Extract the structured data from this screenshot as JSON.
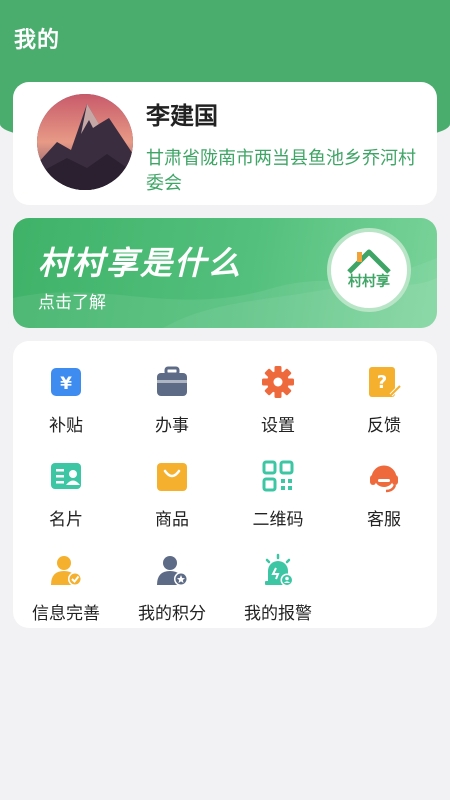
{
  "header": {
    "title": "我的"
  },
  "profile": {
    "name": "李建国",
    "address": "甘肃省陇南市两当县鱼池乡乔河村委会"
  },
  "banner": {
    "title": "村村享是什么",
    "subtitle": "点击了解",
    "logo_text": "村村享"
  },
  "menu": [
    {
      "label": "补贴",
      "icon": "subsidy-icon",
      "color": "#3f8cf0"
    },
    {
      "label": "办事",
      "icon": "briefcase-icon",
      "color": "#5d6b87"
    },
    {
      "label": "设置",
      "icon": "gear-icon",
      "color": "#ee6a3d"
    },
    {
      "label": "反馈",
      "icon": "feedback-icon",
      "color": "#f5b02e"
    },
    {
      "label": "名片",
      "icon": "card-icon",
      "color": "#3cc6a3"
    },
    {
      "label": "商品",
      "icon": "shopping-bag-icon",
      "color": "#f5b02e"
    },
    {
      "label": "二维码",
      "icon": "qrcode-icon",
      "color": "#3cc6a3"
    },
    {
      "label": "客服",
      "icon": "headset-icon",
      "color": "#ee6a3d"
    },
    {
      "label": "信息完善",
      "icon": "user-check-icon",
      "color": "#f5b02e"
    },
    {
      "label": "我的积分",
      "icon": "user-points-icon",
      "color": "#5d6b87"
    },
    {
      "label": "我的报警",
      "icon": "alarm-icon",
      "color": "#3cc6a3"
    }
  ],
  "colors": {
    "primary": "#4aad6e",
    "address": "#3fa566"
  }
}
